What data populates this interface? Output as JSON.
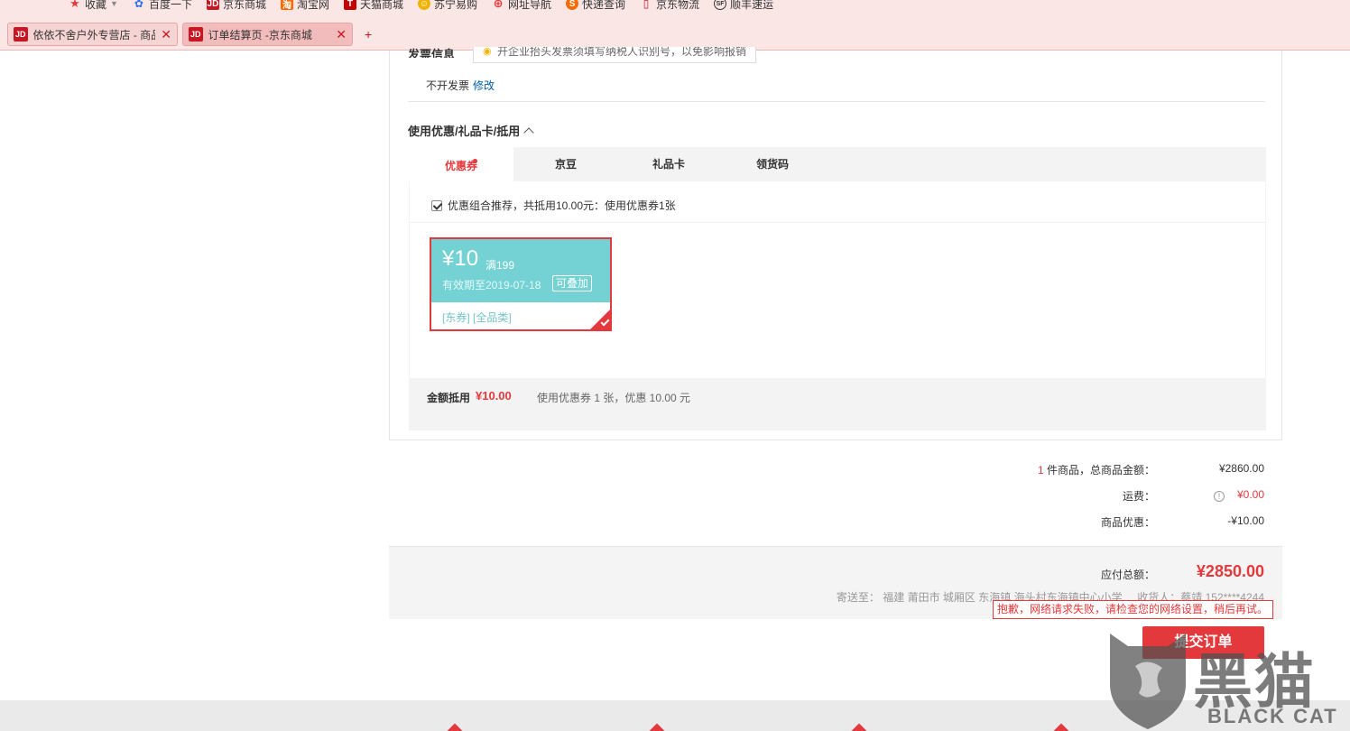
{
  "bookmarks": [
    {
      "label": "收藏",
      "icon": "star-icon",
      "color": "#e4393c"
    },
    {
      "label": "百度一下",
      "icon": "baidu-icon",
      "color": "#2f6ee8"
    },
    {
      "label": "京东商城",
      "icon": "jd-icon",
      "color": "#c81623"
    },
    {
      "label": "淘宝网",
      "icon": "taobao-icon",
      "color": "#ff6a00"
    },
    {
      "label": "天猫商城",
      "icon": "tmall-icon",
      "color": "#c40000"
    },
    {
      "label": "苏宁易购",
      "icon": "suning-icon",
      "color": "#f0b400"
    },
    {
      "label": "网址导航",
      "icon": "globe-icon",
      "color": "#e4393c"
    },
    {
      "label": "快递查询",
      "icon": "express-icon",
      "color": "#ff6a00"
    },
    {
      "label": "京东物流",
      "icon": "document-icon",
      "color": "#c81623"
    },
    {
      "label": "顺丰速运",
      "icon": "sf-icon",
      "color": "#333333"
    }
  ],
  "tabs": [
    {
      "label": "依依不舍户外专营店 - 商品",
      "active": false
    },
    {
      "label": "订单结算页 -京东商城",
      "active": true
    }
  ],
  "invoice": {
    "title": "发票信息",
    "tip": "开企业抬头发票须填写纳税人识别号，以免影响报销",
    "status": "不开发票",
    "edit_label": "修改"
  },
  "discount": {
    "title": "使用优惠/礼品卡/抵用",
    "tabs": [
      "优惠券",
      "京豆",
      "礼品卡",
      "领货码"
    ],
    "recommend_text": "优惠组合推荐，共抵用10.00元：使用优惠券1张",
    "coupon": {
      "amount": "¥10",
      "condition": "满199",
      "validity": "有效期至2019-07-18",
      "stackable": "可叠加",
      "categories": "[东券]  [全品类]"
    },
    "summary_label": "金额抵用",
    "summary_value": "¥10.00",
    "summary_desc": "使用优惠券 1 张，优惠 10.00 元"
  },
  "totals": {
    "count": "1",
    "count_label": " 件商品，总商品金额：",
    "goods_amount": "¥2860.00",
    "shipping_label": "运费：",
    "shipping_value": "¥0.00",
    "discount_label": "商品优惠：",
    "discount_value": "-¥10.00"
  },
  "payment": {
    "label": "应付总额：",
    "total": "¥2850.00",
    "ship_to": "寄送至： 福建 莆田市 城厢区 东海镇 海头村东海镇中心小学",
    "receiver": "收货人：蔡靖 152****4244",
    "error": "抱歉，网络请求失败，请检查您的网络设置，稍后再试。",
    "submit_label": "提交订单"
  },
  "watermark": {
    "text": "黑猫",
    "en": "BLACK CAT"
  },
  "colors": {
    "accent": "#e4393c",
    "coupon_bg": "#74d2d4"
  }
}
